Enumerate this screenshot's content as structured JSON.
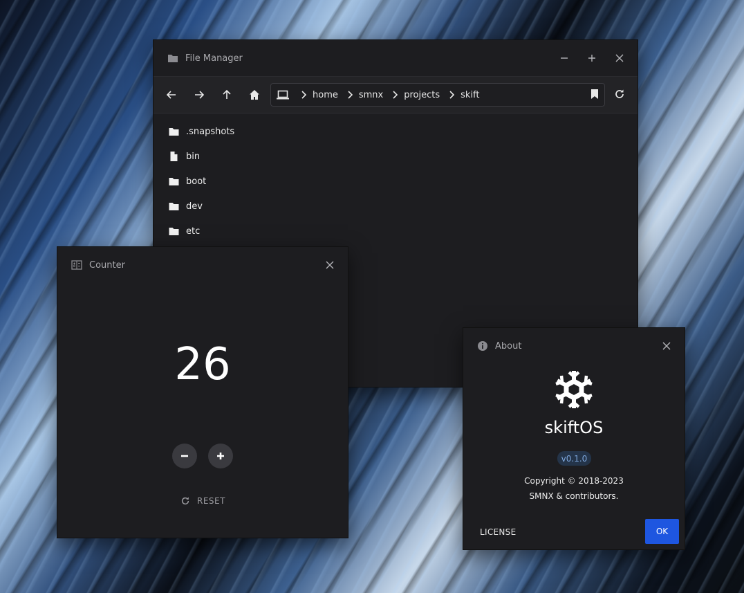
{
  "file_manager": {
    "title": "File Manager",
    "breadcrumbs": [
      "home",
      "smnx",
      "projects",
      "skift"
    ],
    "files": [
      {
        "name": ".snapshots",
        "type": "folder"
      },
      {
        "name": "bin",
        "type": "file"
      },
      {
        "name": "boot",
        "type": "folder"
      },
      {
        "name": "dev",
        "type": "folder"
      },
      {
        "name": "etc",
        "type": "folder"
      }
    ],
    "icons": {
      "title": "folder-icon",
      "minimize": "minimize-icon",
      "maximize": "plus-icon",
      "close": "close-icon",
      "back": "arrow-left-icon",
      "forward": "arrow-right-icon",
      "up": "arrow-up-icon",
      "home": "home-icon",
      "computer": "laptop-icon",
      "bookmark": "bookmark-icon",
      "refresh": "refresh-icon"
    }
  },
  "counter": {
    "title": "Counter",
    "value": "26",
    "reset_label": "RESET",
    "icons": {
      "title": "calculator-icon",
      "close": "close-icon",
      "decrement": "minus-icon",
      "increment": "plus-icon",
      "reset": "reset-icon"
    }
  },
  "about": {
    "title": "About",
    "app_name": "skiftOS",
    "version": "v0.1.0",
    "copyright_line1": "Copyright © 2018-2023",
    "copyright_line2": "SMNX & contributors.",
    "license_label": "LICENSE",
    "ok_label": "OK",
    "icons": {
      "title": "info-icon",
      "close": "close-icon",
      "logo": "snowflake-logo-icon"
    }
  },
  "colors": {
    "window_bg": "#1d1d20",
    "toolbar_bg": "#232326",
    "accent": "#1e56e0",
    "version_badge_bg": "#243449",
    "version_badge_text": "#7fa8de"
  }
}
